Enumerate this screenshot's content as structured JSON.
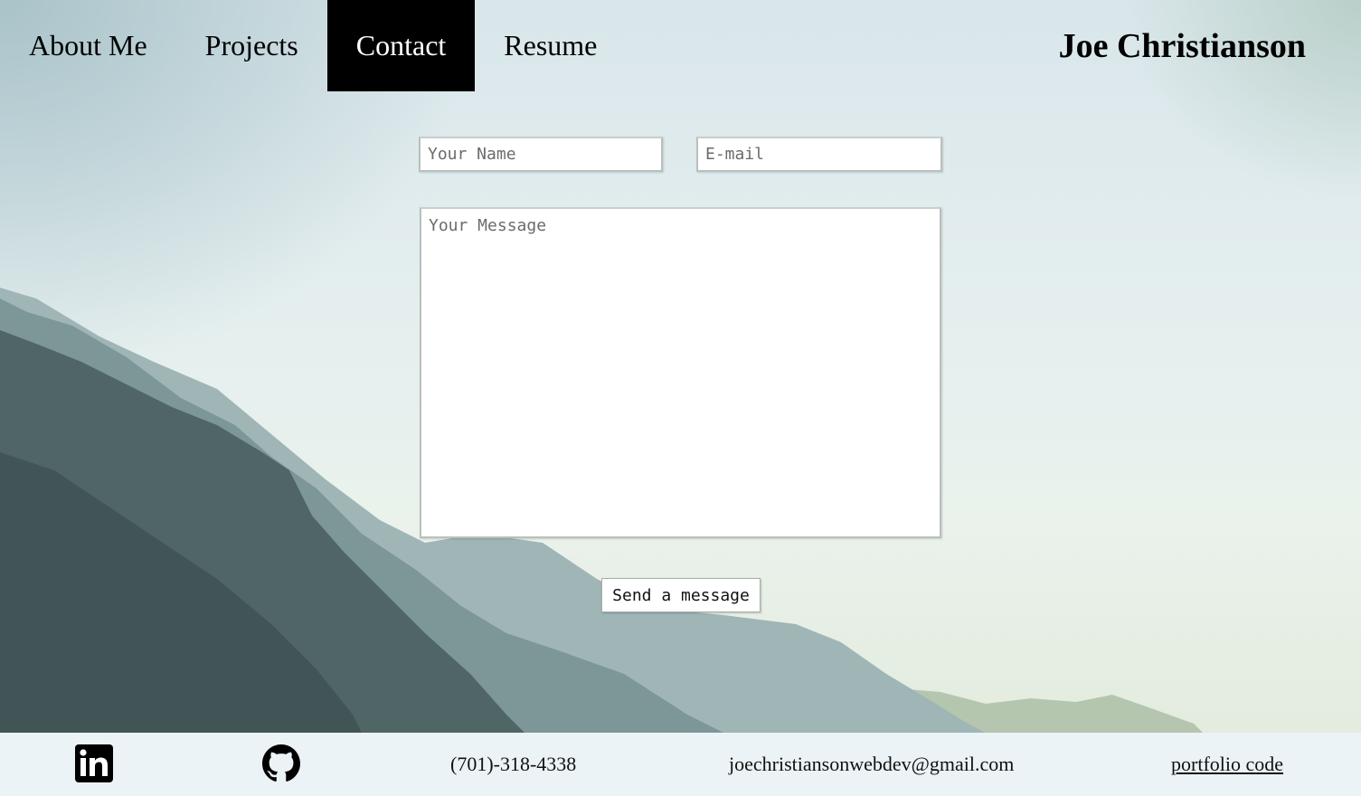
{
  "nav": {
    "items": [
      {
        "label": "About Me",
        "active": false
      },
      {
        "label": "Projects",
        "active": false
      },
      {
        "label": "Contact",
        "active": true
      },
      {
        "label": "Resume",
        "active": false
      }
    ],
    "brand": "Joe Christianson"
  },
  "form": {
    "name_placeholder": "Your Name",
    "email_placeholder": "E-mail",
    "message_placeholder": "Your Message",
    "send_label": "Send a message"
  },
  "footer": {
    "linkedin_icon": "linkedin-icon",
    "github_icon": "github-icon",
    "phone": "(701)-318-4338",
    "email": "joechristiansonwebdev@gmail.com",
    "portfolio_link": "portfolio code"
  },
  "colors": {
    "nav_active_bg": "#000000",
    "footer_bg": "#ebf3f6"
  }
}
